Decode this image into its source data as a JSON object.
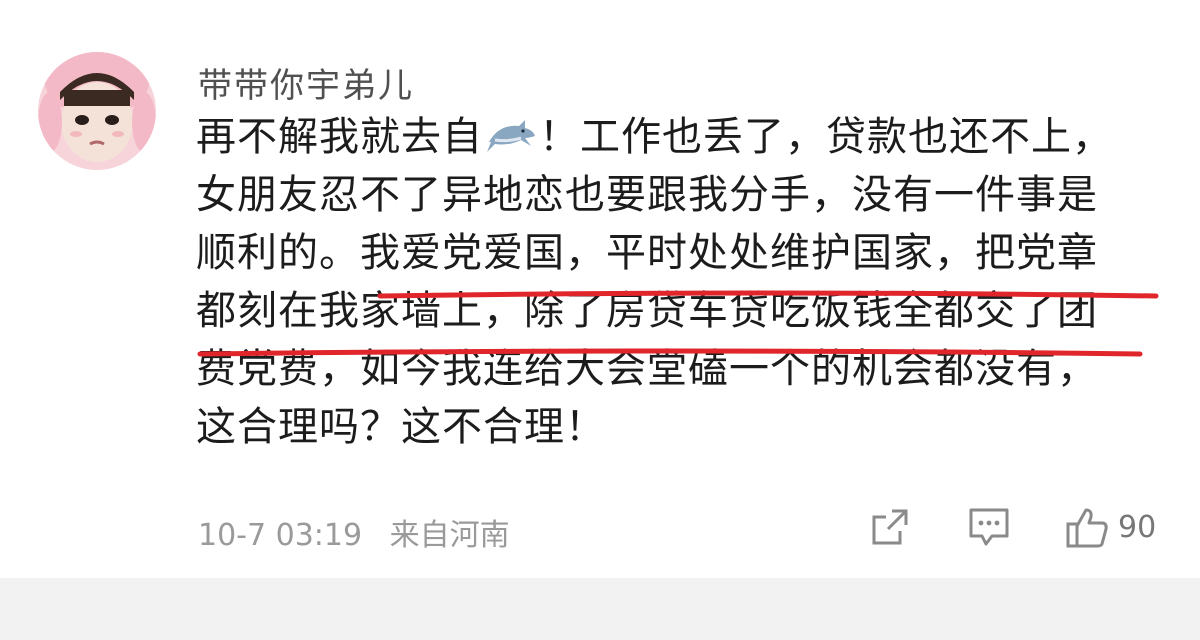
{
  "comment": {
    "username": "带带你宇弟儿",
    "lines": [
      {
        "pre": "再不解我就去自",
        "post": "！工作也丢了，贷款也还不上，"
      },
      {
        "text": "女朋友忍不了异地恋也要跟我分手，没有一件事是"
      },
      {
        "plain": "顺利的。",
        "underlined": "我爱党爱国，平时处处维护国家，把党章"
      },
      {
        "underlined": "都刻在我家墙上，除了房贷车贷吃饭钱全都交了团"
      },
      {
        "text": "费党费，如今我连给大会堂磕一个的机会都没有，"
      },
      {
        "text": "这合理吗？这不合理！"
      }
    ],
    "emoji": "shark-icon",
    "underline_color": "#e0262b",
    "timestamp": "10-7 03:19",
    "location": "来自河南",
    "like_count": "90"
  },
  "actions": {
    "share": "share-icon",
    "reply": "comment-icon",
    "like": "thumbs-up-icon"
  }
}
